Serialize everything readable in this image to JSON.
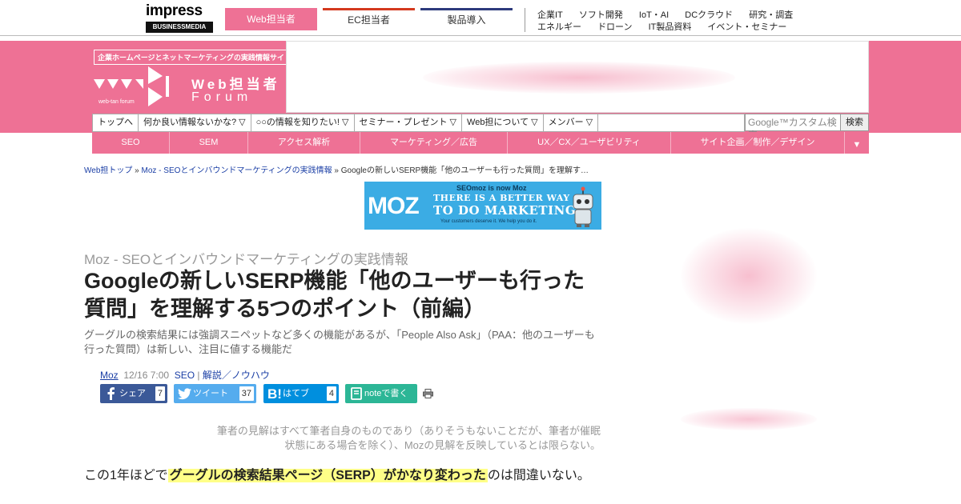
{
  "topbar": {
    "logo": {
      "word": "impress",
      "sub": "BUSINESSMEDIA"
    },
    "tabs": [
      {
        "label": "Web担当者"
      },
      {
        "label": "EC担当者"
      },
      {
        "label": "製品導入"
      }
    ],
    "links_row1": [
      "企業IT",
      "ソフト開発",
      "IoT・AI",
      "DCクラウド",
      "研究・調査"
    ],
    "links_row2": [
      "エネルギー",
      "ドローン",
      "IT製品資料",
      "イベント・セミナー"
    ],
    "colors": {
      "web": "#ee7195",
      "ec": "#d4391e",
      "prod": "#2d3a7c"
    }
  },
  "brand": {
    "tagline": "企業ホームページとネットマーケティングの実践情報サイト",
    "name": "Web担当者",
    "forum": "Forum",
    "small": "web-tan forum",
    "accent": "#ee7195"
  },
  "dropdown_nav": {
    "items": [
      "トップへ",
      "何か良い情報ないかな? ▽",
      "○○の情報を知りたい! ▽",
      "セミナー・プレゼント ▽",
      "Web担について ▽",
      "メンバー ▽"
    ],
    "search_placeholder": "Google™カスタム検索",
    "search_button": "検索"
  },
  "category_nav": {
    "items": [
      "SEO",
      "SEM",
      "アクセス解析",
      "マーケティング／広告",
      "UX／CX／ユーザビリティ",
      "サイト企画／制作／デザイン"
    ],
    "more": "▼"
  },
  "breadcrumb": {
    "home": "Web担トップ",
    "sep": " » ",
    "section": "Moz - SEOとインバウンドマーケティングの実践情報",
    "current": "Googleの新しいSERP機能「他のユーザーも行った質問」を理解す…"
  },
  "moz_ad": {
    "logo": "MOZ",
    "small": "SEOmoz is now Moz",
    "line1": "THERE IS A BETTER WAY",
    "line2": "TO DO MARKETING",
    "line3": "Your customers deserve it.  We help you do it."
  },
  "article": {
    "category": "Moz - SEOとインバウンドマーケティングの実践情報",
    "title": "Googleの新しいSERP機能「他のユーザーも行った質問」を理解する5つのポイント（前編）",
    "lead": "グーグルの検索結果には強調スニペットなど多くの機能があるが、「People Also Ask」（PAA：他のユーザーも行った質問）は新しい、注目に値する機能だ",
    "meta": {
      "author": "Moz",
      "date": "12/16 7:00",
      "tag1": "SEO",
      "tag_sep": "|",
      "tag2": "解説／ノウハウ"
    },
    "share": {
      "facebook": {
        "label": "シェア",
        "count": "7",
        "icon": "facebook-icon"
      },
      "twitter": {
        "label": "ツイート",
        "count": "37",
        "icon": "twitter-icon"
      },
      "hatena": {
        "label": "はてブ",
        "count": "4",
        "icon": "hatena-icon"
      },
      "note": {
        "label": "noteで書く",
        "icon": "note-icon"
      }
    },
    "disclaimer_1": "筆者の見解はすべて筆者自身のものであり（ありそうもないことだが、筆者が催眠",
    "disclaimer_2": "状態にある場合を除く）、Mozの見解を反映しているとは限らない。",
    "body_before": "この1年ほどで",
    "body_highlight": "グーグルの検索結果ページ（SERP）がかなり変わった",
    "body_after": "のは間違いない。"
  }
}
